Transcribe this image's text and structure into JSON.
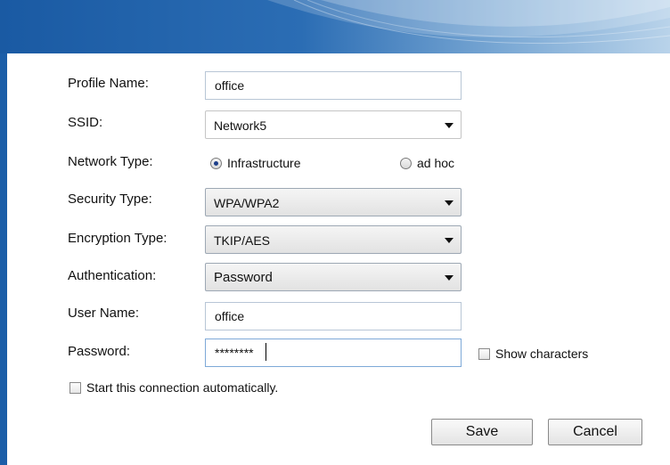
{
  "form": {
    "profile_name": {
      "label": "Profile Name:",
      "value": "office"
    },
    "ssid": {
      "label": "SSID:",
      "value": "Network5"
    },
    "network_type": {
      "label": "Network Type:",
      "options": [
        "Infrastructure",
        "ad hoc"
      ],
      "selected": "Infrastructure"
    },
    "security_type": {
      "label": "Security Type:",
      "value": "WPA/WPA2"
    },
    "encryption_type": {
      "label": "Encryption Type:",
      "value": "TKIP/AES"
    },
    "authentication": {
      "label": "Authentication:",
      "value": "Password"
    },
    "user_name": {
      "label": "User Name:",
      "value": "office"
    },
    "password": {
      "label": "Password:",
      "value": "********",
      "show_characters_label": "Show characters",
      "show_characters_checked": false
    },
    "auto_start": {
      "label": "Start this connection automatically.",
      "checked": false
    }
  },
  "buttons": {
    "save": "Save",
    "cancel": "Cancel"
  },
  "colors": {
    "header_blue": "#1a5aa3",
    "panel": "#ffffff",
    "radio_dot": "#1d3f8a"
  }
}
